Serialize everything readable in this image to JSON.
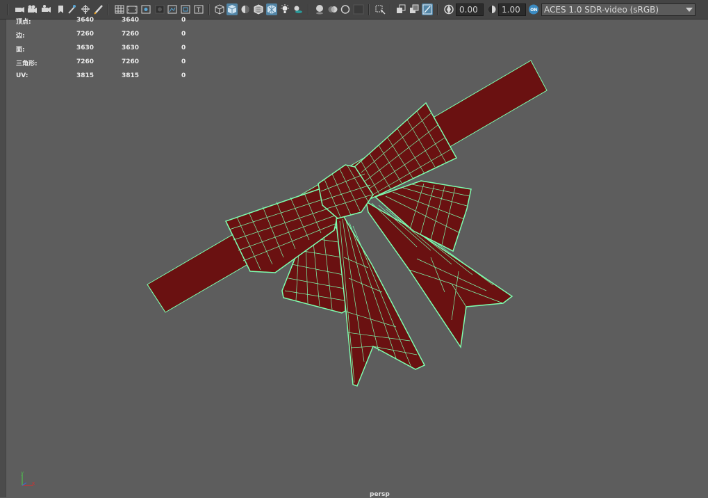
{
  "toolbar": {
    "exposure_value": "0.00",
    "gamma_value": "1.00",
    "color_management_label": "ACES 1.0 SDR-video (sRGB)",
    "icons": [
      "select-camera-icon",
      "camera-attributes-icon",
      "bookmark-icon",
      "image-plane-icon",
      "2d-pan-zoom-icon",
      "grease-pencil-icon",
      "grid-icon",
      "film-gate-icon",
      "resolution-gate-icon",
      "gate-mask-icon",
      "field-chart-icon",
      "safe-action-icon",
      "safe-title-icon",
      "wireframe-icon",
      "smooth-shade-icon",
      "default-material-icon",
      "textured-icon",
      "wireframe-on-shaded-icon",
      "use-all-lights-icon",
      "shadows-icon",
      "screen-space-ao-icon",
      "motion-blur-icon",
      "anti-aliasing-icon",
      "depth-of-field-icon",
      "isolate-select-icon",
      "xray-icon",
      "xray-active-components-icon",
      "xray-joints-icon",
      "exposure-icon",
      "gamma-icon",
      "color-management-toggle-icon"
    ]
  },
  "hud": {
    "rows": [
      {
        "label": "顶点:",
        "a": "3640",
        "b": "3640",
        "c": "0"
      },
      {
        "label": "边:",
        "a": "7260",
        "b": "7260",
        "c": "0"
      },
      {
        "label": "面:",
        "a": "3630",
        "b": "3630",
        "c": "0"
      },
      {
        "label": "三角形:",
        "a": "7260",
        "b": "7260",
        "c": "0"
      },
      {
        "label": "UV:",
        "a": "3815",
        "b": "3815",
        "c": "0"
      }
    ]
  },
  "camera_label": "persp",
  "colors": {
    "viewport_bg": "#5d5d5d",
    "mesh_fill": "#6a1111",
    "wireframe": "#7dffb0",
    "toolbar_bg": "#444444",
    "active_tool": "#5285a6"
  }
}
